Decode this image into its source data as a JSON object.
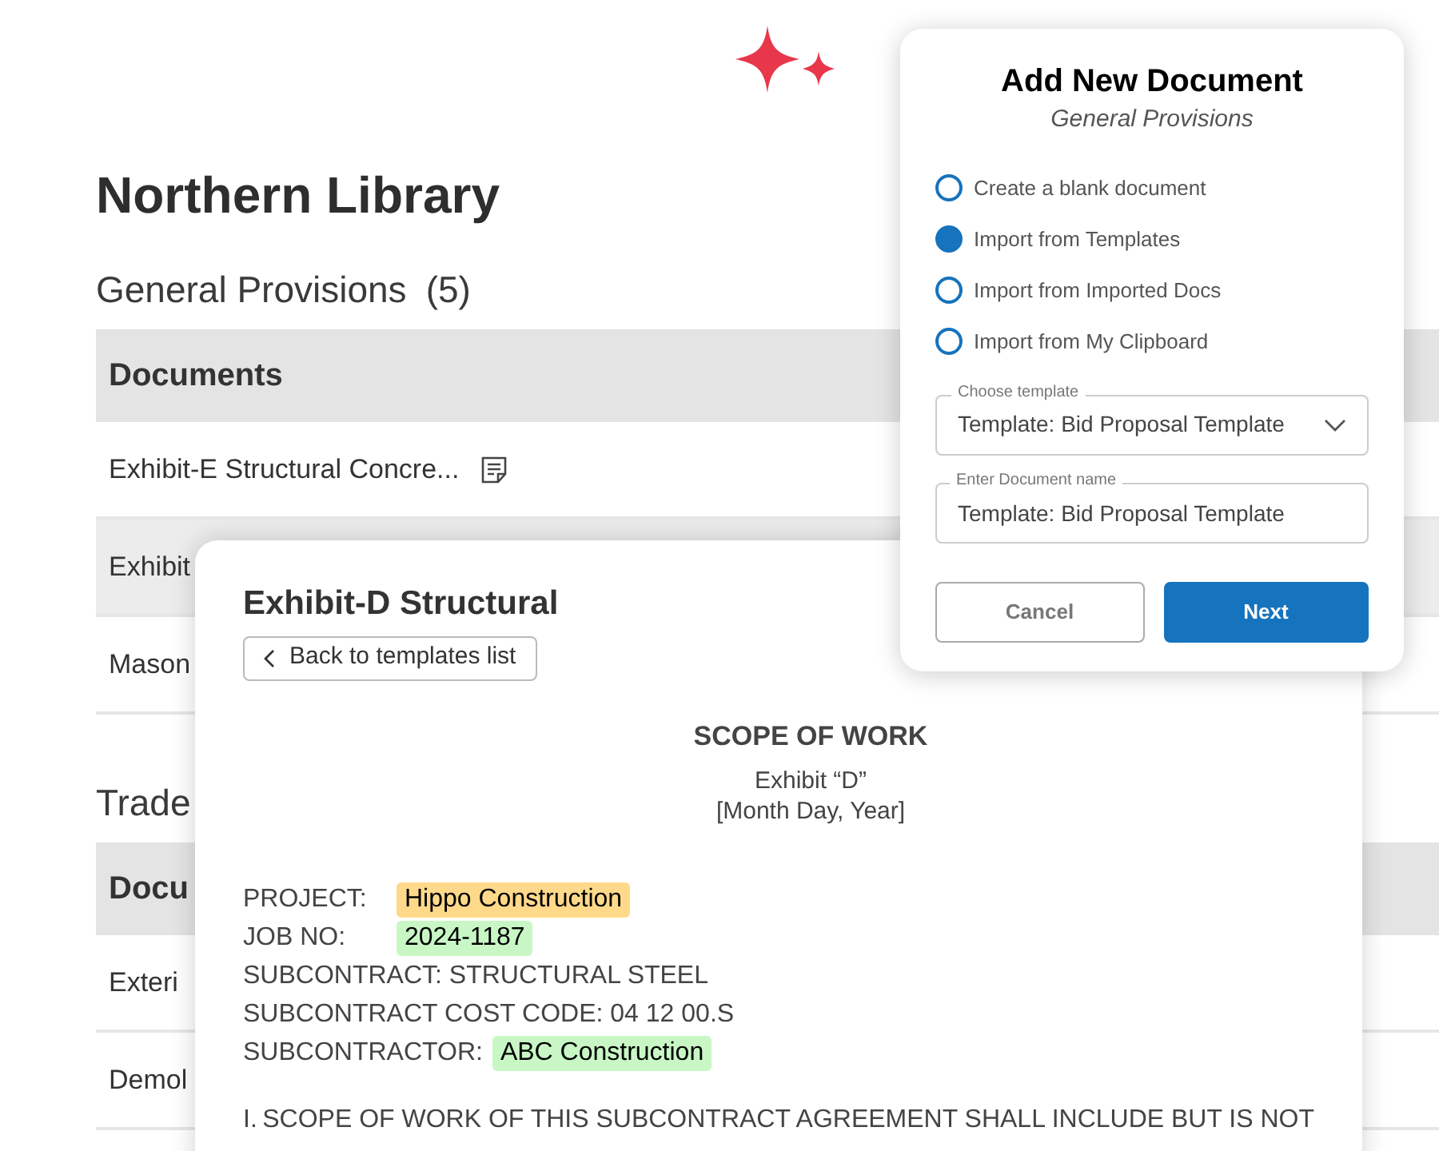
{
  "page": {
    "title": "Northern Library"
  },
  "sections": [
    {
      "title": "General Provisions",
      "count": "(5)",
      "column": "Documents",
      "rows": [
        {
          "name": "Exhibit-E Structural Concre...",
          "kind": "note",
          "highlighted": false
        },
        {
          "name": "Exhibit",
          "kind": "plain",
          "highlighted": true
        },
        {
          "name": "Mason",
          "kind": "plain",
          "highlighted": false
        }
      ]
    },
    {
      "title": "Trade",
      "column": "Docu",
      "rows": [
        {
          "name": "Exteri",
          "kind": "plain",
          "highlighted": false
        },
        {
          "name": "Demol",
          "kind": "plain",
          "highlighted": false
        }
      ]
    }
  ],
  "template_preview": {
    "title": "Exhibit-D Structural",
    "back_button": "Back to templates list",
    "heading": "SCOPE OF WORK",
    "subtitle": [
      "Exhibit “D”",
      "[Month Day, Year]"
    ],
    "lines": [
      {
        "kind": "field",
        "label": "PROJECT:",
        "value": "Hippo Construction",
        "color": "#ffd98a"
      },
      {
        "kind": "field",
        "label": "JOB NO:",
        "value": "2024-1187",
        "color": "#c8f7c5"
      },
      {
        "kind": "text",
        "text": "SUBCONTRACT: STRUCTURAL STEEL"
      },
      {
        "kind": "text",
        "text": "SUBCONTRACT COST CODE: 04 12 00.S"
      },
      {
        "kind": "field",
        "label": "SUBCONTRACTOR:",
        "value": "ABC Construction",
        "color": "#c8f7c5"
      }
    ],
    "clause": {
      "number": "I.",
      "text": "SCOPE OF WORK OF THIS SUBCONTRACT AGREEMENT SHALL INCLUDE BUT IS NOT"
    }
  },
  "dialog": {
    "title": "Add New Document",
    "subtitle": "General Provisions",
    "options": [
      {
        "label": "Create a blank document",
        "selected": false
      },
      {
        "label": "Import from Templates",
        "selected": true
      },
      {
        "label": "Import from Imported Docs",
        "selected": false
      },
      {
        "label": "Import from My Clipboard",
        "selected": false
      }
    ],
    "template_select": {
      "label": "Choose template",
      "value": "Template: Bid Proposal Template"
    },
    "name_field": {
      "label": "Enter Document name",
      "value": "Template: Bid Proposal Template"
    },
    "buttons": {
      "cancel": "Cancel",
      "next": "Next"
    }
  }
}
